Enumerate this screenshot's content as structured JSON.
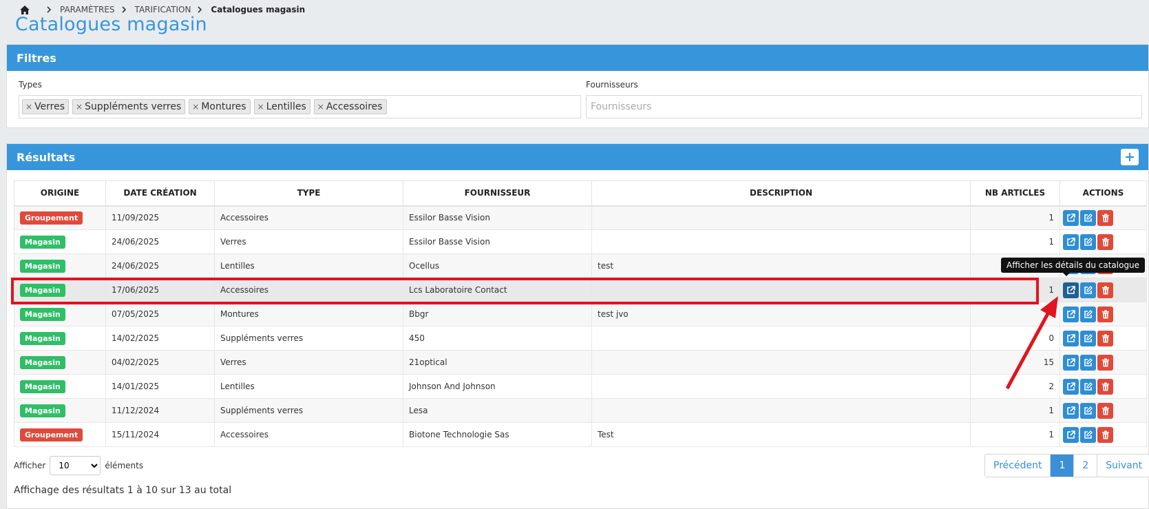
{
  "breadcrumb": {
    "items": [
      "PARAMÈTRES",
      "TARIFICATION"
    ],
    "current": "Catalogues magasin"
  },
  "page_title": "Catalogues magasin",
  "filters": {
    "title": "Filtres",
    "types_label": "Types",
    "types_tags": [
      "Verres",
      "Suppléments verres",
      "Montures",
      "Lentilles",
      "Accessoires"
    ],
    "suppliers_label": "Fournisseurs",
    "suppliers_placeholder": "Fournisseurs"
  },
  "results": {
    "title": "Résultats",
    "columns": [
      "ORIGINE",
      "DATE CRÉATION",
      "TYPE",
      "FOURNISSEUR",
      "DESCRIPTION",
      "NB ARTICLES",
      "ACTIONS"
    ],
    "rows": [
      {
        "origine": "Groupement",
        "date": "11/09/2025",
        "type": "Accessoires",
        "fournisseur": "Essilor Basse Vision",
        "description": "",
        "nb": "1"
      },
      {
        "origine": "Magasin",
        "date": "24/06/2025",
        "type": "Verres",
        "fournisseur": "Essilor Basse Vision",
        "description": "",
        "nb": "1"
      },
      {
        "origine": "Magasin",
        "date": "24/06/2025",
        "type": "Lentilles",
        "fournisseur": "Ocellus",
        "description": "test",
        "nb": ""
      },
      {
        "origine": "Magasin",
        "date": "17/06/2025",
        "type": "Accessoires",
        "fournisseur": "Lcs Laboratoire Contact",
        "description": "",
        "nb": "1"
      },
      {
        "origine": "Magasin",
        "date": "07/05/2025",
        "type": "Montures",
        "fournisseur": "Bbgr",
        "description": "test jvo",
        "nb": ""
      },
      {
        "origine": "Magasin",
        "date": "14/02/2025",
        "type": "Suppléments verres",
        "fournisseur": "450",
        "description": "",
        "nb": "0"
      },
      {
        "origine": "Magasin",
        "date": "04/02/2025",
        "type": "Verres",
        "fournisseur": "21optical",
        "description": "",
        "nb": "15"
      },
      {
        "origine": "Magasin",
        "date": "14/01/2025",
        "type": "Lentilles",
        "fournisseur": "Johnson And Johnson",
        "description": "",
        "nb": "2"
      },
      {
        "origine": "Magasin",
        "date": "11/12/2024",
        "type": "Suppléments verres",
        "fournisseur": "Lesa",
        "description": "",
        "nb": "1"
      },
      {
        "origine": "Groupement",
        "date": "15/11/2024",
        "type": "Accessoires",
        "fournisseur": "Biotone Technologie Sas",
        "description": "Test",
        "nb": "1"
      }
    ],
    "highlighted_row": 3,
    "tooltip": "Afficher les détails du catalogue"
  },
  "length_menu": {
    "prefix": "Afficher",
    "value": "10",
    "suffix": "éléments"
  },
  "info": "Affichage des résultats 1 à 10 sur 13 au total",
  "pagination": {
    "prev": "Précédent",
    "pages": [
      "1",
      "2"
    ],
    "next": "Suivant",
    "active": "1"
  },
  "colors": {
    "primary": "#3796db",
    "groupement": "#e04a3a",
    "magasin": "#2fbf66",
    "delete": "#e04a3a",
    "annotation": "#e0141e"
  }
}
